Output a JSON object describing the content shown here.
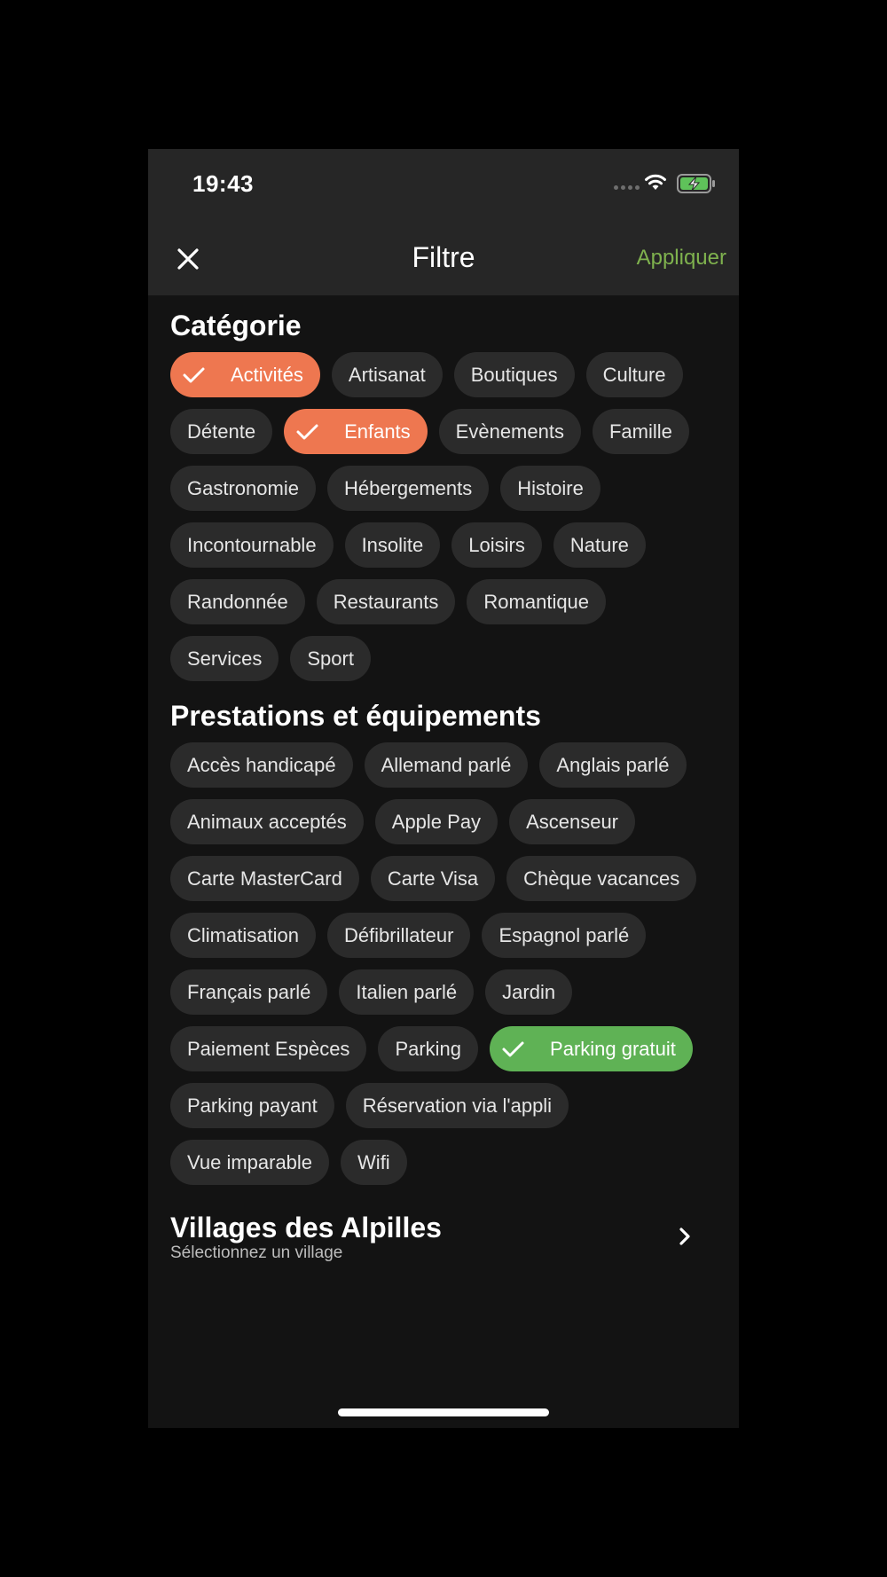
{
  "status_bar": {
    "time": "19:43"
  },
  "header": {
    "title": "Filtre",
    "apply_label": "Appliquer"
  },
  "categorie": {
    "title": "Catégorie",
    "chips": [
      {
        "label": "Activités",
        "selected": true,
        "color": "#ee7750"
      },
      {
        "label": "Artisanat",
        "selected": false
      },
      {
        "label": "Boutiques",
        "selected": false
      },
      {
        "label": "Culture",
        "selected": false
      },
      {
        "label": "Détente",
        "selected": false
      },
      {
        "label": "Enfants",
        "selected": true,
        "color": "#ee7750"
      },
      {
        "label": "Evènements",
        "selected": false
      },
      {
        "label": "Famille",
        "selected": false
      },
      {
        "label": "Gastronomie",
        "selected": false
      },
      {
        "label": "Hébergements",
        "selected": false
      },
      {
        "label": "Histoire",
        "selected": false
      },
      {
        "label": "Incontournable",
        "selected": false
      },
      {
        "label": "Insolite",
        "selected": false
      },
      {
        "label": "Loisirs",
        "selected": false
      },
      {
        "label": "Nature",
        "selected": false
      },
      {
        "label": "Randonnée",
        "selected": false
      },
      {
        "label": "Restaurants",
        "selected": false
      },
      {
        "label": "Romantique",
        "selected": false
      },
      {
        "label": "Services",
        "selected": false
      },
      {
        "label": "Sport",
        "selected": false
      }
    ]
  },
  "prestations": {
    "title": "Prestations et équipements",
    "chips": [
      {
        "label": "Accès handicapé",
        "selected": false
      },
      {
        "label": "Allemand parlé",
        "selected": false
      },
      {
        "label": "Anglais parlé",
        "selected": false
      },
      {
        "label": "Animaux acceptés",
        "selected": false
      },
      {
        "label": "Apple Pay",
        "selected": false
      },
      {
        "label": "Ascenseur",
        "selected": false
      },
      {
        "label": "Carte MasterCard",
        "selected": false
      },
      {
        "label": "Carte Visa",
        "selected": false
      },
      {
        "label": "Chèque vacances",
        "selected": false
      },
      {
        "label": "Climatisation",
        "selected": false
      },
      {
        "label": "Défibrillateur",
        "selected": false
      },
      {
        "label": "Espagnol parlé",
        "selected": false
      },
      {
        "label": "Français parlé",
        "selected": false
      },
      {
        "label": "Italien parlé",
        "selected": false
      },
      {
        "label": "Jardin",
        "selected": false
      },
      {
        "label": "Paiement Espèces",
        "selected": false
      },
      {
        "label": "Parking",
        "selected": false
      },
      {
        "label": "Parking gratuit",
        "selected": true,
        "color": "#5fb255"
      },
      {
        "label": "Parking payant",
        "selected": false
      },
      {
        "label": "Réservation via l'appli",
        "selected": false
      },
      {
        "label": "Vue imparable",
        "selected": false
      },
      {
        "label": "Wifi",
        "selected": false
      }
    ]
  },
  "villages": {
    "title": "Villages des Alpilles",
    "subtitle": "Sélectionnez un village"
  },
  "colors": {
    "accent_apply": "#7fb24e",
    "chip_bg": "#2b2b2b",
    "background": "#131313",
    "bar_bg": "#262626"
  },
  "icons": {
    "close": "close-icon",
    "check": "checkmark-icon",
    "chevron": "chevron-right-icon",
    "wifi": "wifi-icon",
    "battery": "battery-charging-icon",
    "signal": "cellular-signal-icon"
  }
}
